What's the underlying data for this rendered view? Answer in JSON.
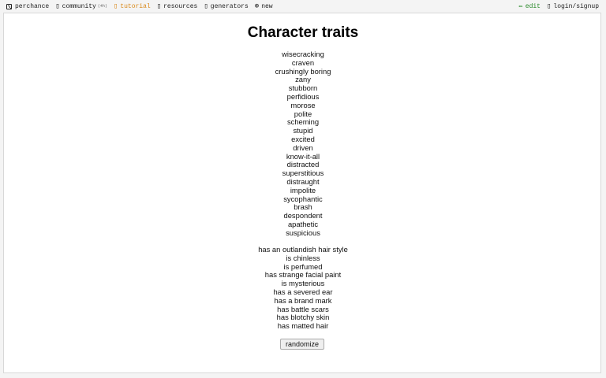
{
  "topbar": {
    "brand": "perchance",
    "community": "community",
    "community_count": "(4h)",
    "tutorial": "tutorial",
    "resources": "resources",
    "generators": "generators",
    "new": "new",
    "edit": "edit",
    "login": "login/signup",
    "colors": {
      "tutorial": "#d98a1c",
      "edit": "#2a8a2a"
    },
    "icons": [
      "dice-icon",
      "chat-icon",
      "book-icon",
      "folder-icon",
      "grid-icon",
      "plus-circle-icon",
      "pencil-icon",
      "user-icon"
    ]
  },
  "page": {
    "title": "Character traits",
    "traits": [
      "wisecracking",
      "craven",
      "crushingly boring",
      "zany",
      "stubborn",
      "perfidious",
      "morose",
      "polite",
      "scheming",
      "stupid",
      "excited",
      "driven",
      "know-it-all",
      "distracted",
      "superstitious",
      "distraught",
      "impolite",
      "sycophantic",
      "brash",
      "despondent",
      "apathetic",
      "suspicious"
    ],
    "features": [
      "has an outlandish hair style",
      "is chinless",
      "is perfumed",
      "has strange facial paint",
      "is mysterious",
      "has a severed ear",
      "has a brand mark",
      "has battle scars",
      "has blotchy skin",
      "has matted hair"
    ],
    "button": "randomize"
  }
}
